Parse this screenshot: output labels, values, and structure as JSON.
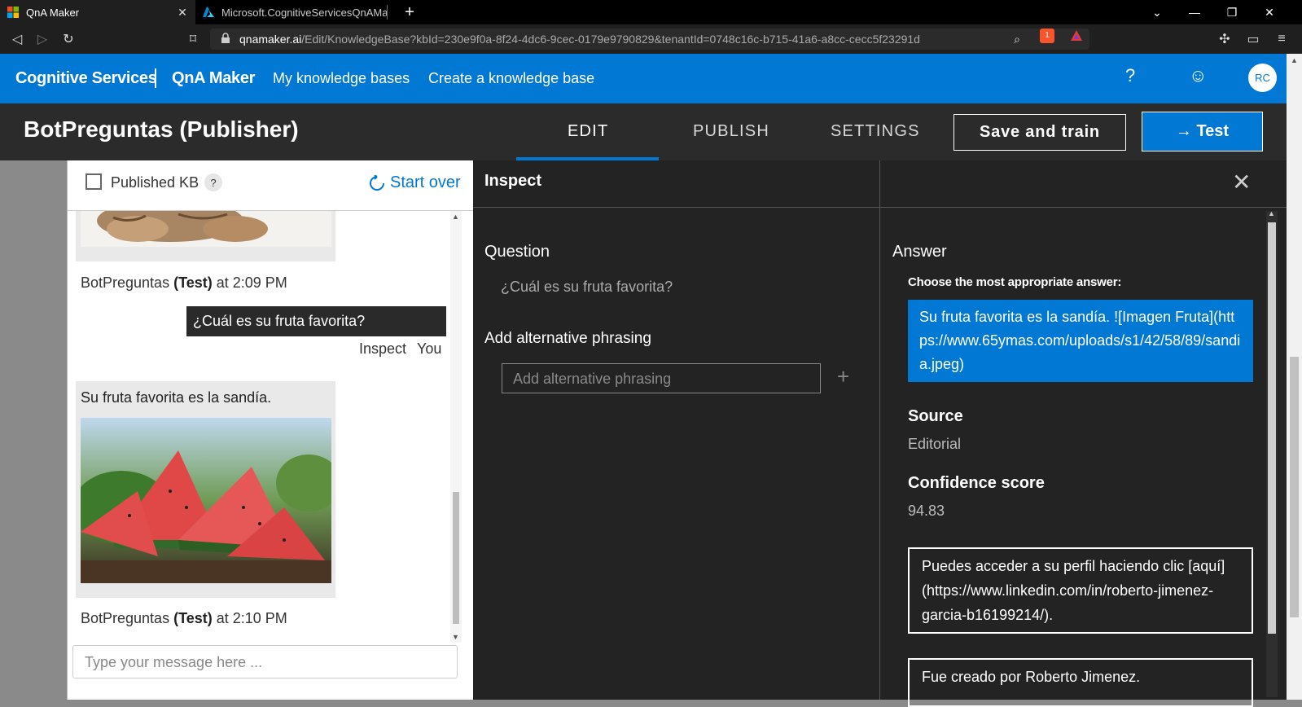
{
  "browser": {
    "tabs": [
      {
        "title": "QnA Maker",
        "active": true
      },
      {
        "title": "Microsoft.CognitiveServicesQnAMaker",
        "active": false
      }
    ],
    "url_domain": "qnamaker.ai",
    "url_path": "/Edit/KnowledgeBase?kbId=230e9f0a-8f24-4dc6-9cec-0179e9790829&tenantId=0748c16c-b715-41a6-a8cc-cecc5f23291d",
    "brave_count": "1"
  },
  "header": {
    "brand": "Cognitive Services",
    "product": "QnA Maker",
    "nav": [
      "My knowledge bases",
      "Create a knowledge base"
    ],
    "help_icon": "?",
    "avatar": "RC"
  },
  "subheader": {
    "kb_title": "BotPreguntas (Publisher)",
    "tabs": [
      "EDIT",
      "PUBLISH",
      "SETTINGS"
    ],
    "active_tab": "EDIT",
    "save_label": "Save and train",
    "test_label": "→ Test"
  },
  "chat": {
    "published_kb_label": "Published KB",
    "help_badge": "?",
    "start_over": "Start over",
    "meta_1": {
      "prefix": "BotPreguntas ",
      "bold": "(Test)",
      "suffix": " at 2:09 PM"
    },
    "user_message": "¿Cuál es su fruta favorita?",
    "inspect_link": "Inspect",
    "you_label": "You",
    "bot_reply": "Su fruta favorita es la sandía.",
    "meta_2": {
      "prefix": "BotPreguntas ",
      "bold": "(Test)",
      "suffix": " at 2:10 PM"
    },
    "input_placeholder": "Type your message here ..."
  },
  "inspect": {
    "title": "Inspect",
    "question_label": "Question",
    "question_text": "¿Cuál es su fruta favorita?",
    "alt_label": "Add alternative phrasing",
    "alt_placeholder": "Add alternative phrasing",
    "answer_label": "Answer",
    "choose_label": "Choose the most appropriate answer:",
    "selected_answer": "Su fruta favorita es la sandía. ![Imagen Fruta](https://www.65ymas.com/uploads/s1/42/58/89/sandia.jpeg)",
    "source_label": "Source",
    "source_value": "Editorial",
    "confidence_label": "Confidence score",
    "confidence_value": "94.83",
    "alt_answers": [
      "Puedes acceder a su perfil haciendo clic [aquí](https://www.linkedin.com/in/roberto-jimenez-garcia-b16199214/).",
      "Fue creado por Roberto Jimenez."
    ]
  },
  "colors": {
    "accent": "#0078d4",
    "dark_panel": "#232323"
  }
}
